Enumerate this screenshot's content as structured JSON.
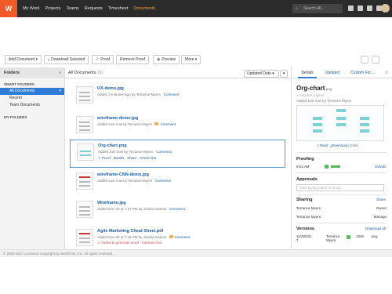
{
  "nav": {
    "items": [
      "My Work",
      "Projects",
      "Teams",
      "Requests",
      "Timesheet",
      "Documents"
    ],
    "search_placeholder": "Search All..."
  },
  "toolbar": {
    "add_document": "Add Document",
    "download_selected": "Download Selected",
    "proof": "Proof",
    "remove_proof": "Remove Proof",
    "preview": "Preview",
    "more": "More"
  },
  "sidebar": {
    "title": "Folders",
    "smart_folders": "SMART FOLDERS",
    "items": [
      "All Documents",
      "Recent",
      "Team Documents"
    ],
    "my_folders": "MY FOLDERS"
  },
  "main": {
    "title": "All Documents",
    "count": "(6)",
    "sort": "Updated Date"
  },
  "documents": [
    {
      "title": "UX-demo.jpg",
      "meta": "Added 3 minutes ago by Terrance Myers",
      "comment": "Comment"
    },
    {
      "title": "wireframe-demo.jpg",
      "meta": "Added Just now by Terrance Myers",
      "comment": "Comment"
    },
    {
      "title": "Org-chart.png",
      "meta": "Added Just now by Terrance Myers",
      "comment": "Comment",
      "actions": [
        "Proof",
        "Details",
        "Share",
        "Check Out"
      ]
    },
    {
      "title": "wireframe-CNN-demo.jpg",
      "meta": "Added Just now by Terrance Myers",
      "comment": "Comment"
    },
    {
      "title": "Wireframe.jpg",
      "meta": "Added Nov 30 at 7:47 PM by Juliana Santos",
      "comment": "Comment"
    },
    {
      "title": "Agile Marketing Cheat Sheet.pdf",
      "meta": "Added Nov 30 at 7:46 PM by Juliana Santos",
      "comment": "Comment",
      "error": "Failed to generate proof · Internal error"
    }
  ],
  "panel": {
    "tabs": [
      "Details",
      "Updates",
      "Custom For..."
    ],
    "title": "Org-chart",
    "ext": ".png",
    "add_description": "+ Add Description",
    "added": "Added Just now by Terrance Myers",
    "proof_link": "Proof",
    "download_link": "Download",
    "size": "[104K]",
    "proofing": {
      "label": "Proofing",
      "time": "9:53 AM",
      "details": "Details"
    },
    "approvals": {
      "label": "Approvals",
      "placeholder": "Start typing name or email..."
    },
    "sharing": {
      "label": "Sharing",
      "share": "Share",
      "rows": [
        {
          "name": "Terrance Myers",
          "role": "Owner"
        },
        {
          "name": "Terrance Myers",
          "role": "Manage"
        }
      ]
    },
    "versions": {
      "label": "Versions",
      "download_all": "Download All",
      "date": "11/28/201 7",
      "name": "Terrance Myers",
      "size": "104K",
      "type": "png"
    }
  },
  "footer": "© 2000-2017 Licensed Copyright by Workfront, Inc. All rights reserved."
}
